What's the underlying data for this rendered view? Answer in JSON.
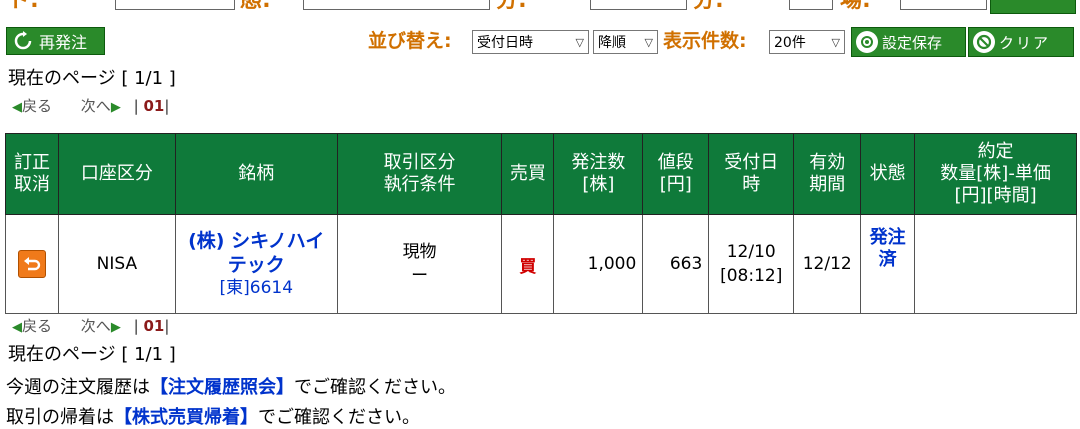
{
  "filter_row": {
    "label_a": "ド:",
    "label_b": "態:",
    "label_c": "分:",
    "label_d": "分:",
    "label_e": "場:"
  },
  "toolbar": {
    "reissue_label": "再発注",
    "sort_label": "並び替え:",
    "sort_field": "受付日時",
    "sort_order": "降順",
    "count_label": "表示件数:",
    "count_value": "20件",
    "save_label": "設定保存",
    "clear_label": "クリア"
  },
  "pagination": {
    "current_page_text": "現在のページ [ 1/1 ]",
    "prev_label": "戻る",
    "next_label": "次へ",
    "page_sep_left": "|",
    "page_number": "01",
    "page_sep_right": "|"
  },
  "table": {
    "headers": {
      "modify": [
        "訂正",
        "取消"
      ],
      "account": "口座区分",
      "stock": "銘柄",
      "trade_type": [
        "取引区分",
        "執行条件"
      ],
      "side": "売買",
      "qty": [
        "発注数",
        "[株]"
      ],
      "price": [
        "値段",
        "[円]"
      ],
      "accepted": [
        "受付日",
        "時"
      ],
      "expiry": [
        "有効",
        "期間"
      ],
      "status": "状態",
      "executed": [
        "約定",
        "数量[株]-単価",
        "[円][時間]"
      ]
    },
    "rows": [
      {
        "account": "NISA",
        "stock_name_1": "(株) シキノハイ",
        "stock_name_2": "テック",
        "stock_code": "[東]6614",
        "trade_type": "現物",
        "condition": "ー",
        "side": "買",
        "qty": "1,000",
        "price": "663",
        "accepted_date": "12/10",
        "accepted_time": "[08:12]",
        "expiry": "12/12",
        "status_1": "発注",
        "status_2": "済",
        "executed": ""
      }
    ]
  },
  "footer": {
    "line1_pre": "今週の注文履歴は",
    "line1_link": "【注文履歴照会】",
    "line1_post": "でご確認ください。",
    "line2_pre": "取引の帰着は",
    "line2_link": "【株式売買帰着】",
    "line2_post": "でご確認ください。"
  },
  "colors": {
    "accent_green": "#2a8a2a",
    "header_green": "#0f7a3a",
    "label_orange": "#d07000",
    "link_blue": "#0033cc",
    "buy_red": "#d00000"
  },
  "icons": {
    "reissue": "refresh-icon",
    "save": "target-icon",
    "clear": "no-entry-icon",
    "undo": "undo-arrow-icon",
    "prev": "triangle-left-icon",
    "next": "triangle-right-icon"
  }
}
